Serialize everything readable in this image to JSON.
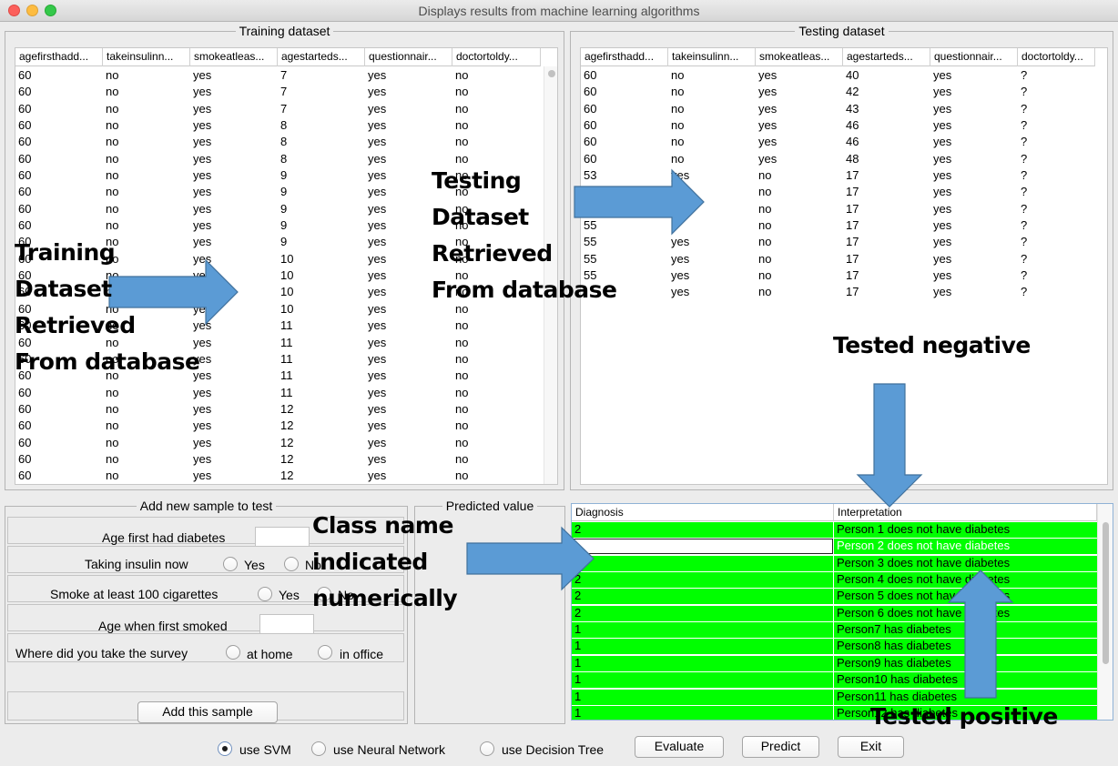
{
  "window": {
    "title": "Displays results from machine learning algorithms"
  },
  "training": {
    "title": "Training dataset",
    "columns": [
      "agefirsthadd...",
      "takeinsulinn...",
      "smokeatleas...",
      "agestarteds...",
      "questionnair...",
      "doctortoldy..."
    ],
    "rows": [
      [
        "60",
        "no",
        "yes",
        "7",
        "yes",
        "no"
      ],
      [
        "60",
        "no",
        "yes",
        "7",
        "yes",
        "no"
      ],
      [
        "60",
        "no",
        "yes",
        "7",
        "yes",
        "no"
      ],
      [
        "60",
        "no",
        "yes",
        "8",
        "yes",
        "no"
      ],
      [
        "60",
        "no",
        "yes",
        "8",
        "yes",
        "no"
      ],
      [
        "60",
        "no",
        "yes",
        "8",
        "yes",
        "no"
      ],
      [
        "60",
        "no",
        "yes",
        "9",
        "yes",
        "no"
      ],
      [
        "60",
        "no",
        "yes",
        "9",
        "yes",
        "no"
      ],
      [
        "60",
        "no",
        "yes",
        "9",
        "yes",
        "no"
      ],
      [
        "60",
        "no",
        "yes",
        "9",
        "yes",
        "no"
      ],
      [
        "60",
        "no",
        "yes",
        "9",
        "yes",
        "no"
      ],
      [
        "60",
        "no",
        "yes",
        "10",
        "yes",
        "no"
      ],
      [
        "60",
        "no",
        "yes",
        "10",
        "yes",
        "no"
      ],
      [
        "60",
        "no",
        "yes",
        "10",
        "yes",
        "no"
      ],
      [
        "60",
        "no",
        "yes",
        "10",
        "yes",
        "no"
      ],
      [
        "60",
        "no",
        "yes",
        "11",
        "yes",
        "no"
      ],
      [
        "60",
        "no",
        "yes",
        "11",
        "yes",
        "no"
      ],
      [
        "60",
        "no",
        "yes",
        "11",
        "yes",
        "no"
      ],
      [
        "60",
        "no",
        "yes",
        "11",
        "yes",
        "no"
      ],
      [
        "60",
        "no",
        "yes",
        "11",
        "yes",
        "no"
      ],
      [
        "60",
        "no",
        "yes",
        "12",
        "yes",
        "no"
      ],
      [
        "60",
        "no",
        "yes",
        "12",
        "yes",
        "no"
      ],
      [
        "60",
        "no",
        "yes",
        "12",
        "yes",
        "no"
      ],
      [
        "60",
        "no",
        "yes",
        "12",
        "yes",
        "no"
      ],
      [
        "60",
        "no",
        "yes",
        "12",
        "yes",
        "no"
      ]
    ]
  },
  "testing": {
    "title": "Testing dataset",
    "columns": [
      "agefirsthadd...",
      "takeinsulinn...",
      "smokeatleas...",
      "agestarteds...",
      "questionnair...",
      "doctortoldy..."
    ],
    "rows": [
      [
        "60",
        "no",
        "yes",
        "40",
        "yes",
        "?"
      ],
      [
        "60",
        "no",
        "yes",
        "42",
        "yes",
        "?"
      ],
      [
        "60",
        "no",
        "yes",
        "43",
        "yes",
        "?"
      ],
      [
        "60",
        "no",
        "yes",
        "46",
        "yes",
        "?"
      ],
      [
        "60",
        "no",
        "yes",
        "46",
        "yes",
        "?"
      ],
      [
        "60",
        "no",
        "yes",
        "48",
        "yes",
        "?"
      ],
      [
        "53",
        "yes",
        "no",
        "17",
        "yes",
        "?"
      ],
      [
        "",
        "",
        "no",
        "17",
        "yes",
        "?"
      ],
      [
        "",
        "",
        "no",
        "17",
        "yes",
        "?"
      ],
      [
        "55",
        "",
        "no",
        "17",
        "yes",
        "?"
      ],
      [
        "55",
        "yes",
        "no",
        "17",
        "yes",
        "?"
      ],
      [
        "55",
        "yes",
        "no",
        "17",
        "yes",
        "?"
      ],
      [
        "55",
        "yes",
        "no",
        "17",
        "yes",
        "?"
      ],
      [
        "",
        "yes",
        "no",
        "17",
        "yes",
        "?"
      ]
    ]
  },
  "form": {
    "title": "Add new sample to test",
    "age_first_label": "Age first had diabetes",
    "age_first_value": "",
    "insulin_label": "Taking insulin now",
    "insulin_yes": "Yes",
    "insulin_no": "No",
    "smoke_label": "Smoke at least 100 cigarettes",
    "smoke_yes": "Yes",
    "smoke_no": "No",
    "age_smoked_label": "Age when first smoked",
    "age_smoked_value": "",
    "survey_label": "Where did you take the survey",
    "survey_home": "at home",
    "survey_office": "in office",
    "add_button": "Add this sample"
  },
  "predicted": {
    "title": "Predicted value"
  },
  "results": {
    "columns": [
      "Diagnosis",
      "Interpretation"
    ],
    "rows": [
      {
        "diagnosis": "2",
        "interpretation": "Person 1 does not have diabetes"
      },
      {
        "diagnosis": "",
        "interpretation": "Person 2 does not have diabetes"
      },
      {
        "diagnosis": "",
        "interpretation": "Person 3 does not have diabetes"
      },
      {
        "diagnosis": "2",
        "interpretation": "Person 4 does not have diabetes"
      },
      {
        "diagnosis": "2",
        "interpretation": "Person 5 does not have diabetes"
      },
      {
        "diagnosis": "2",
        "interpretation": "Person 6 does not have diabetes"
      },
      {
        "diagnosis": "1",
        "interpretation": "Person7 has diabetes"
      },
      {
        "diagnosis": "1",
        "interpretation": "Person8 has diabetes"
      },
      {
        "diagnosis": "1",
        "interpretation": "Person9 has diabetes"
      },
      {
        "diagnosis": "1",
        "interpretation": "Person10 has diabetes"
      },
      {
        "diagnosis": "1",
        "interpretation": "Person11 has diabetes"
      },
      {
        "diagnosis": "1",
        "interpretation": "Person12 has diabetes"
      }
    ],
    "highlight_color": "#00ff00"
  },
  "algorithms": {
    "svm": "use SVM",
    "nn": "use Neural Network",
    "dt": "use Decision Tree",
    "selected": "svm"
  },
  "buttons": {
    "evaluate": "Evaluate",
    "predict": "Predict",
    "exit": "Exit"
  },
  "annotations": {
    "training": [
      "Training",
      "Dataset",
      "Retrieved",
      "From database"
    ],
    "testing": [
      "Testing",
      "Dataset",
      "Retrieved",
      "From database"
    ],
    "tested_negative": "Tested negative",
    "class_name": [
      "Class name",
      "indicated",
      "numerically"
    ],
    "tested_positive": "Tested positive",
    "arrow_color": "#5b9bd5"
  }
}
